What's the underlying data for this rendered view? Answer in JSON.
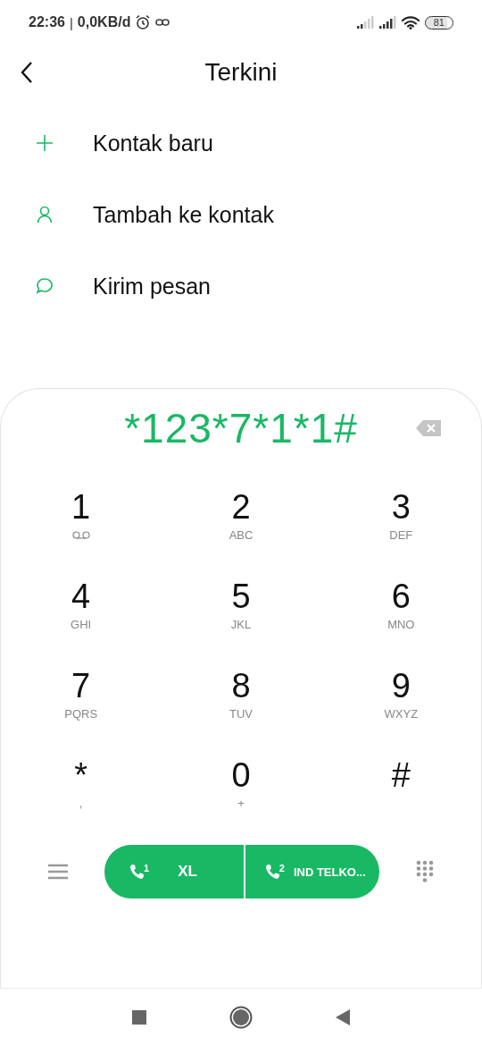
{
  "status_bar": {
    "time": "22:36",
    "separator": "|",
    "data_speed": "0,0KB/d",
    "battery": "81"
  },
  "header": {
    "title": "Terkini"
  },
  "actions": [
    {
      "kind": "add",
      "label": "Kontak baru"
    },
    {
      "kind": "contact",
      "label": "Tambah ke kontak"
    },
    {
      "kind": "message",
      "label": "Kirim pesan"
    }
  ],
  "dialpad": {
    "number": "*123*7*1*1#",
    "keys": [
      {
        "digit": "1",
        "kind": "voicemail"
      },
      {
        "digit": "2",
        "kind": "letters",
        "sub": "ABC"
      },
      {
        "digit": "3",
        "kind": "letters",
        "sub": "DEF"
      },
      {
        "digit": "4",
        "kind": "letters",
        "sub": "GHI"
      },
      {
        "digit": "5",
        "kind": "letters",
        "sub": "JKL"
      },
      {
        "digit": "6",
        "kind": "letters",
        "sub": "MNO"
      },
      {
        "digit": "7",
        "kind": "letters",
        "sub": "PQRS"
      },
      {
        "digit": "8",
        "kind": "letters",
        "sub": "TUV"
      },
      {
        "digit": "9",
        "kind": "letters",
        "sub": "WXYZ"
      },
      {
        "digit": "*",
        "kind": "letters",
        "sub": ","
      },
      {
        "digit": "0",
        "kind": "letters",
        "sub": "+"
      },
      {
        "digit": "#",
        "kind": "plain"
      }
    ]
  },
  "call_buttons": [
    {
      "sim": "1",
      "label": "XL"
    },
    {
      "sim": "2",
      "label": "IND TELKO..."
    }
  ]
}
